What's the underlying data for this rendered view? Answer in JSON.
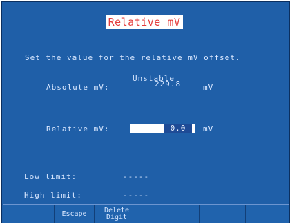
{
  "screen": {
    "title": "Relative mV",
    "instruction": "Set the value for the relative mV offset.",
    "status": "Unstable",
    "absolute_label": "Absolute mV:",
    "absolute_value": "229.8",
    "absolute_unit": "mV",
    "relative_label": "Relative mV:",
    "relative_value": "0.0",
    "relative_unit": "mV",
    "low_limit_label": "Low limit:",
    "low_limit_value": "-----",
    "high_limit_label": "High limit:",
    "high_limit_value": "-----"
  },
  "softkeys": [
    {
      "label": ""
    },
    {
      "label": "Escape"
    },
    {
      "label": "Delete\nDigit"
    },
    {
      "label": ""
    },
    {
      "label": ""
    },
    {
      "label": ""
    }
  ],
  "colors": {
    "screen_background": "#1f5fa8",
    "text": "#d8e7ff",
    "title_text": "#e43d3d",
    "highlight": "#ffffff"
  }
}
